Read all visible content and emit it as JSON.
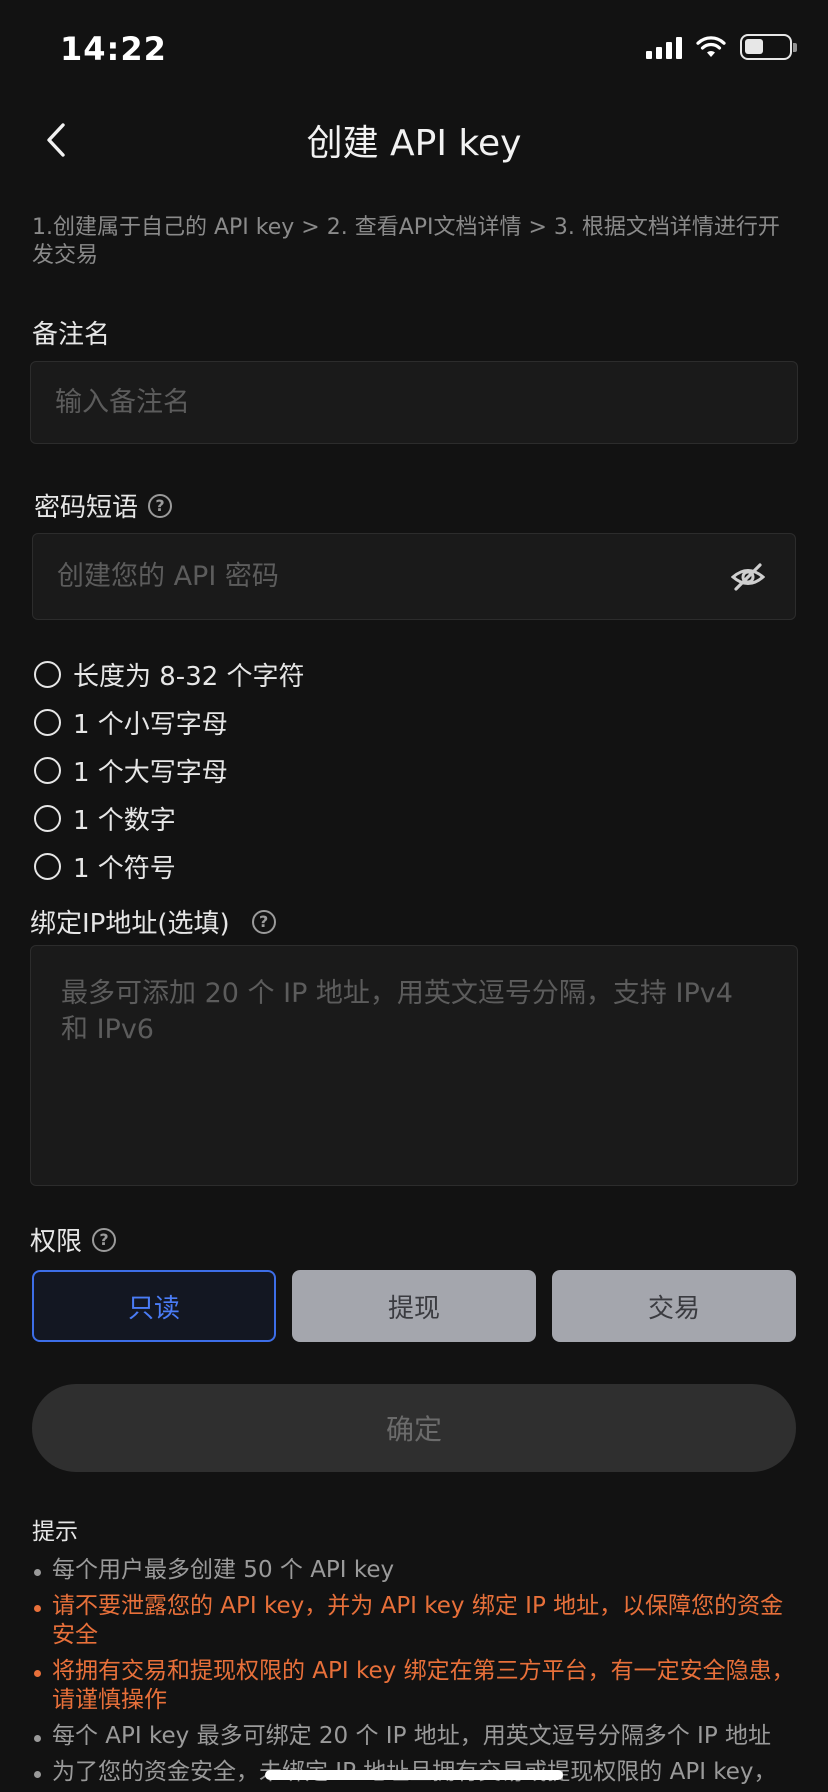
{
  "status": {
    "time": "14:22"
  },
  "header": {
    "title": "创建 API key"
  },
  "steps_text": "1.创建属于自己的 API key > 2. 查看API文档详情 > 3. 根据文档详情进行开发交易",
  "remark": {
    "label": "备注名",
    "placeholder": "输入备注名"
  },
  "passphrase": {
    "label": "密码短语",
    "placeholder": "创建您的 API 密码",
    "rules": [
      "长度为 8-32 个字符",
      "1 个小写字母",
      "1 个大写字母",
      "1 个数字",
      "1 个符号"
    ]
  },
  "ip": {
    "label": "绑定IP地址(选填)",
    "placeholder": "最多可添加 20 个 IP 地址，用英文逗号分隔，支持 IPv4 和 IPv6"
  },
  "permissions": {
    "label": "权限",
    "options": [
      "只读",
      "提现",
      "交易"
    ],
    "selected": "只读"
  },
  "confirm_label": "确定",
  "tips": {
    "title": "提示",
    "items": [
      {
        "text": "每个用户最多创建 50 个 API key",
        "warn": false
      },
      {
        "text": "请不要泄露您的 API key，并为 API key 绑定 IP 地址，以保障您的资金安全",
        "warn": true
      },
      {
        "text": "将拥有交易和提现权限的 API key 绑定在第三方平台，有一定安全隐患，请谨慎操作",
        "warn": true
      },
      {
        "text": "每个 API key 最多可绑定 20 个 IP 地址，用英文逗号分隔多个 IP 地址",
        "warn": false
      },
      {
        "text": "为了您的资金安全，未绑定 IP 地址且拥有交易或提现权限的 API key，",
        "warn": false
      }
    ]
  },
  "colors": {
    "accent": "#4a7cf6",
    "warning": "#e8703a",
    "background": "#121212"
  },
  "icons": {
    "back": "chevron-left-icon",
    "help": "question-circle-icon",
    "visibility": "eye-off-icon"
  }
}
